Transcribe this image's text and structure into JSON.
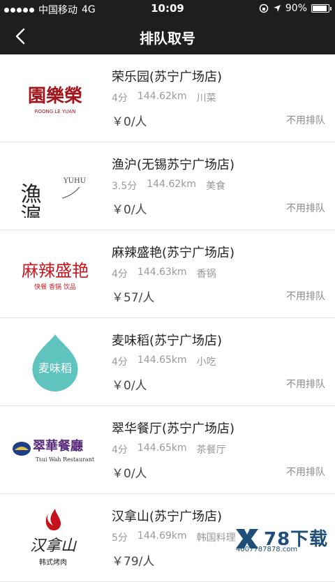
{
  "status_bar": {
    "carrier": "中国移动",
    "network": "4G",
    "time": "10:09",
    "battery": "90%",
    "battery_level": 0.9
  },
  "nav": {
    "title": "排队取号"
  },
  "restaurants": [
    {
      "name": "荣乐园(苏宁广场店)",
      "rating": "4分",
      "distance": "144.62km",
      "category": "川菜",
      "price": "￥0/人",
      "queue": "不用排队",
      "logo_text": "園樂榮",
      "logo_sub": "ROONG LE YUAN"
    },
    {
      "name": "渔沪(无锡苏宁广场店)",
      "rating": "3.5分",
      "distance": "144.62km",
      "category": "美食",
      "price": "￥0/人",
      "queue": "不用排队",
      "logo_text": "漁滬",
      "logo_sub": "YUHU"
    },
    {
      "name": "麻辣盛艳(苏宁广场店)",
      "rating": "4分",
      "distance": "144.63km",
      "category": "香锅",
      "price": "￥57/人",
      "queue": "不用排队",
      "logo_text": "麻辣盛艳",
      "logo_sub": "快餐  香锅  饮品"
    },
    {
      "name": "麦味稻(苏宁广场店)",
      "rating": "4分",
      "distance": "144.65km",
      "category": "小吃",
      "price": "￥0/人",
      "queue": "不用排队",
      "logo_text": "麦味稻",
      "logo_sub": ""
    },
    {
      "name": "翠华餐厅(苏宁广场店)",
      "rating": "4分",
      "distance": "144.65km",
      "category": "茶餐厅",
      "price": "￥0/人",
      "queue": "不用排队",
      "logo_text": "翠華餐廳",
      "logo_sub": "Tsui Wah Restaurant"
    },
    {
      "name": "汉拿山(苏宁广场店)",
      "rating": "5分",
      "distance": "144.69km",
      "category": "韩国料理",
      "price": "￥79/人",
      "queue": "",
      "logo_text": "汉拿山",
      "logo_sub": "韩式烤肉"
    }
  ],
  "watermark": {
    "brand": "78下载",
    "phone": "4007787878.com"
  },
  "colors": {
    "bar": "#1e1e1e",
    "row_bg": "#ffffff",
    "muted": "#999999"
  }
}
